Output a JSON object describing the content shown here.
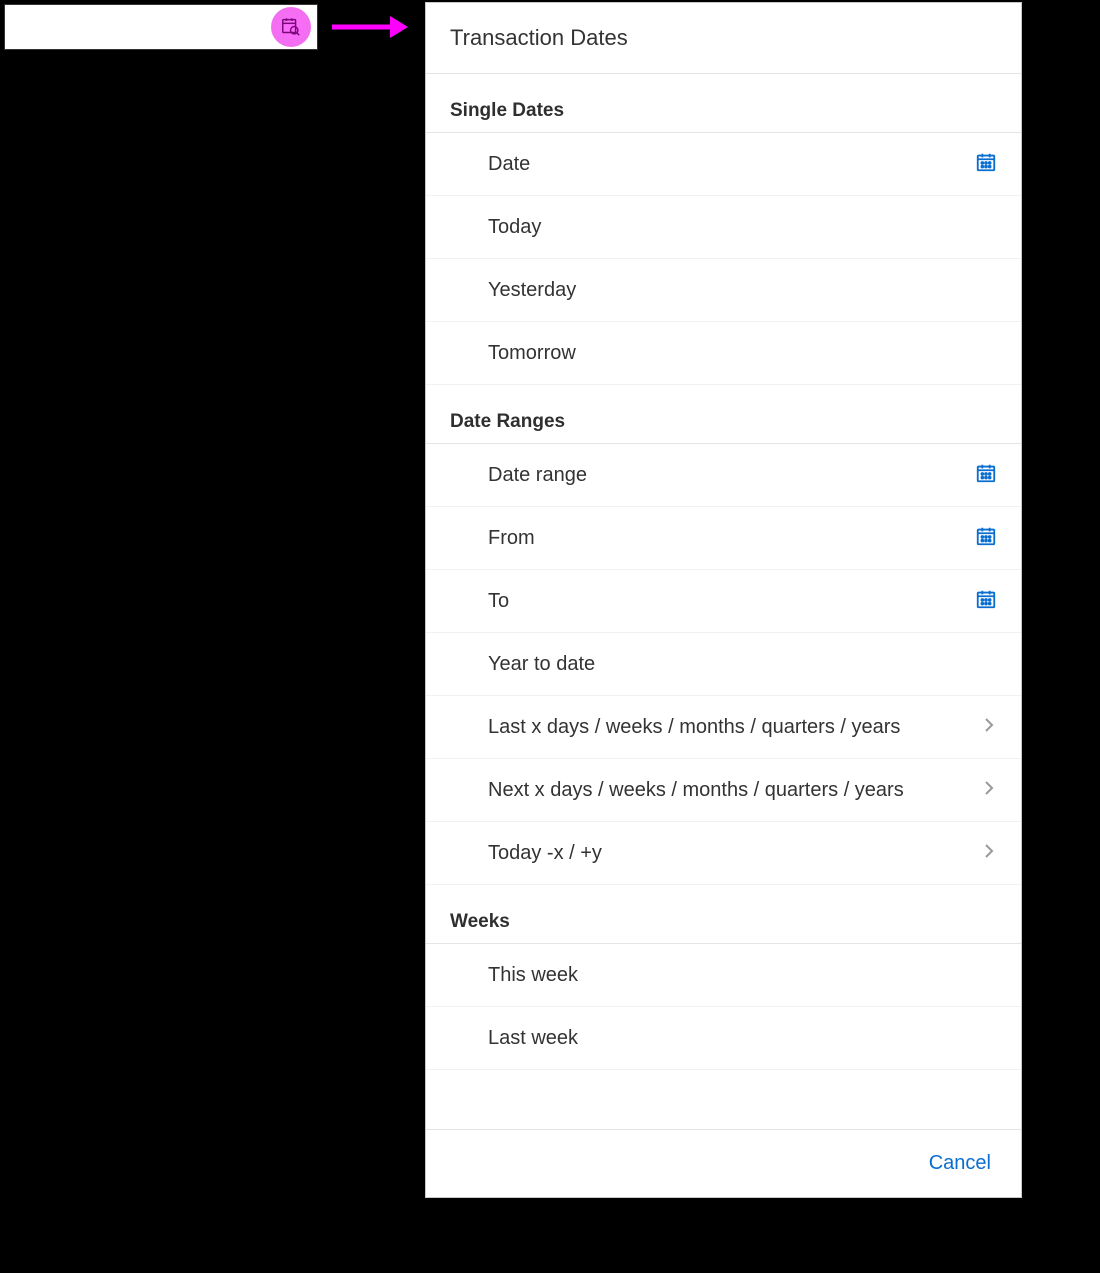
{
  "panel": {
    "title": "Transaction Dates",
    "footer": {
      "cancel_label": "Cancel"
    },
    "groups": {
      "single": {
        "header": "Single Dates",
        "items": {
          "date": "Date",
          "today": "Today",
          "yesterday": "Yesterday",
          "tomorrow": "Tomorrow"
        }
      },
      "ranges": {
        "header": "Date Ranges",
        "items": {
          "date_range": "Date range",
          "from": "From",
          "to": "To",
          "ytd": "Year to date",
          "last_x": "Last x days / weeks / months / quarters / years",
          "next_x": "Next x days / weeks / months / quarters / years",
          "today_xy": "Today -x / +y"
        }
      },
      "weeks": {
        "header": "Weeks",
        "items": {
          "this_week": "This week",
          "last_week": "Last week"
        }
      }
    }
  },
  "colors": {
    "link": "#0a6ed1",
    "highlight": "#ff00ff"
  }
}
